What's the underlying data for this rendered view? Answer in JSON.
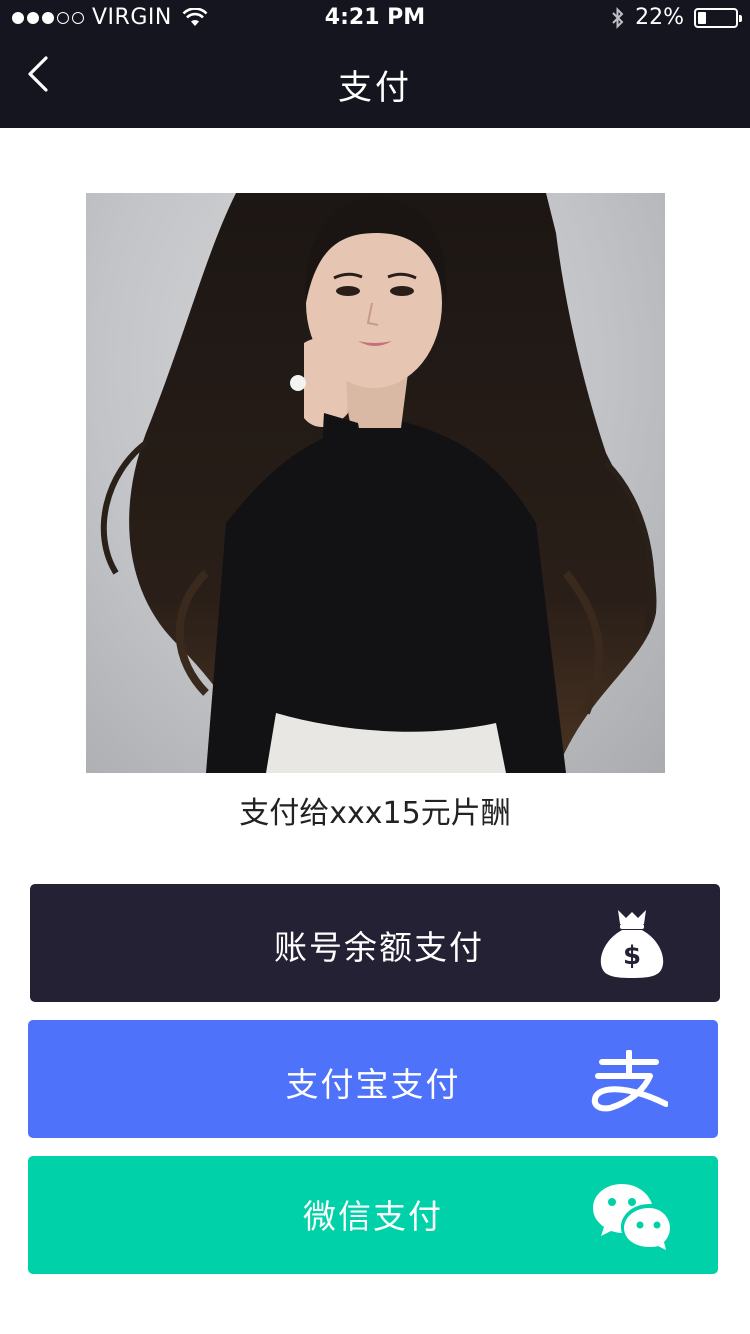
{
  "status_bar": {
    "carrier": "VIRGIN",
    "time": "4:21 PM",
    "battery": "22%",
    "battery_level": 0.22,
    "signal_bars_filled": 3,
    "signal_bars_total": 5
  },
  "nav": {
    "title": "支付",
    "back_icon": "chevron-left-icon"
  },
  "caption": "支付给xxx15元片酬",
  "buttons": {
    "balance": {
      "label": "账号余额支付",
      "icon": "money-bag-icon",
      "color": "#232133"
    },
    "alipay": {
      "label": "支付宝支付",
      "icon": "alipay-icon",
      "color": "#4f72fb"
    },
    "wechat": {
      "label": "微信支付",
      "icon": "wechat-icon",
      "color": "#00d1a8"
    }
  },
  "colors": {
    "header_bg": "#15151f",
    "page_bg": "#ffffff"
  }
}
